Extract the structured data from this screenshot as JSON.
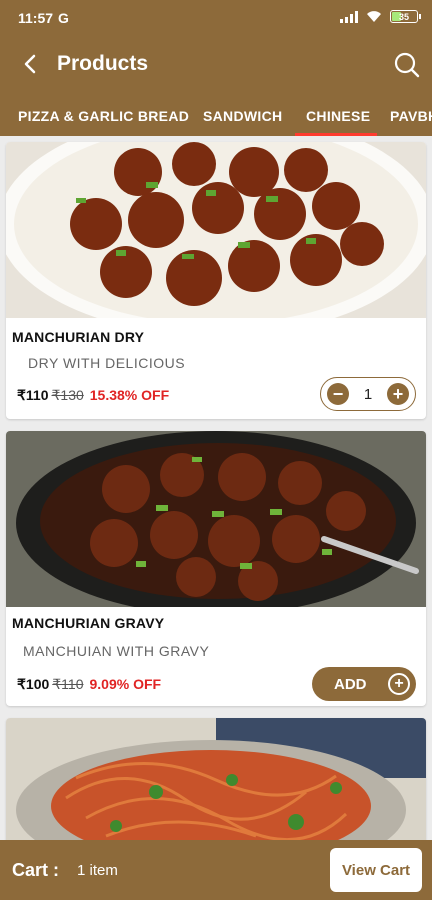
{
  "status": {
    "time": "11:57",
    "carrier_icon": "G",
    "battery": "35"
  },
  "header": {
    "title": "Products"
  },
  "tabs": [
    "PIZZA & GARLIC BREAD",
    "SANDWICH",
    "CHINESE",
    "PAVBH"
  ],
  "active_tab": "CHINESE",
  "products": [
    {
      "name": "MANCHURIAN DRY",
      "desc": "DRY WITH DELICIOUS",
      "price": "₹110",
      "mrp": "₹130",
      "off": "15.38% OFF",
      "qty": "1"
    },
    {
      "name": "MANCHURIAN GRAVY",
      "desc": "MANCHUIAN WITH GRAVY",
      "price": "₹100",
      "mrp": "₹110",
      "off": "9.09% OFF",
      "add_label": "ADD"
    }
  ],
  "cart": {
    "label": "Cart :",
    "count": "1 item",
    "button": "View Cart"
  },
  "colors": {
    "brand": "#8d6a3a",
    "accent": "#ff3b2f",
    "discount": "#e02424"
  }
}
